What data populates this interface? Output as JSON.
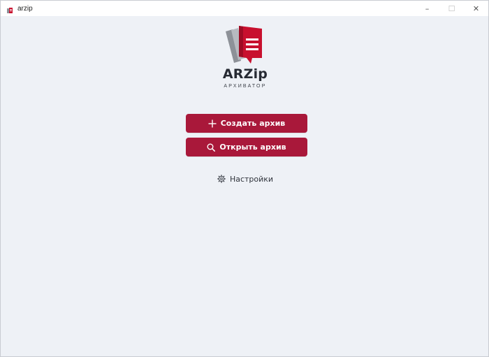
{
  "window": {
    "title": "arzip",
    "controls": {
      "minimize": "–",
      "maximize": "☐",
      "close": "✕"
    }
  },
  "brand": {
    "name": "ARZip",
    "subtitle": "АРХИВАТОР",
    "colors": {
      "accent": "#a9183a",
      "logo_red": "#c8102e",
      "logo_gray": "#8d9198"
    }
  },
  "actions": {
    "create": {
      "label": "Создать архив",
      "icon": "plus-icon"
    },
    "open": {
      "label": "Открыть архив",
      "icon": "search-icon"
    }
  },
  "settings": {
    "label": "Настройки",
    "icon": "gear-icon"
  }
}
